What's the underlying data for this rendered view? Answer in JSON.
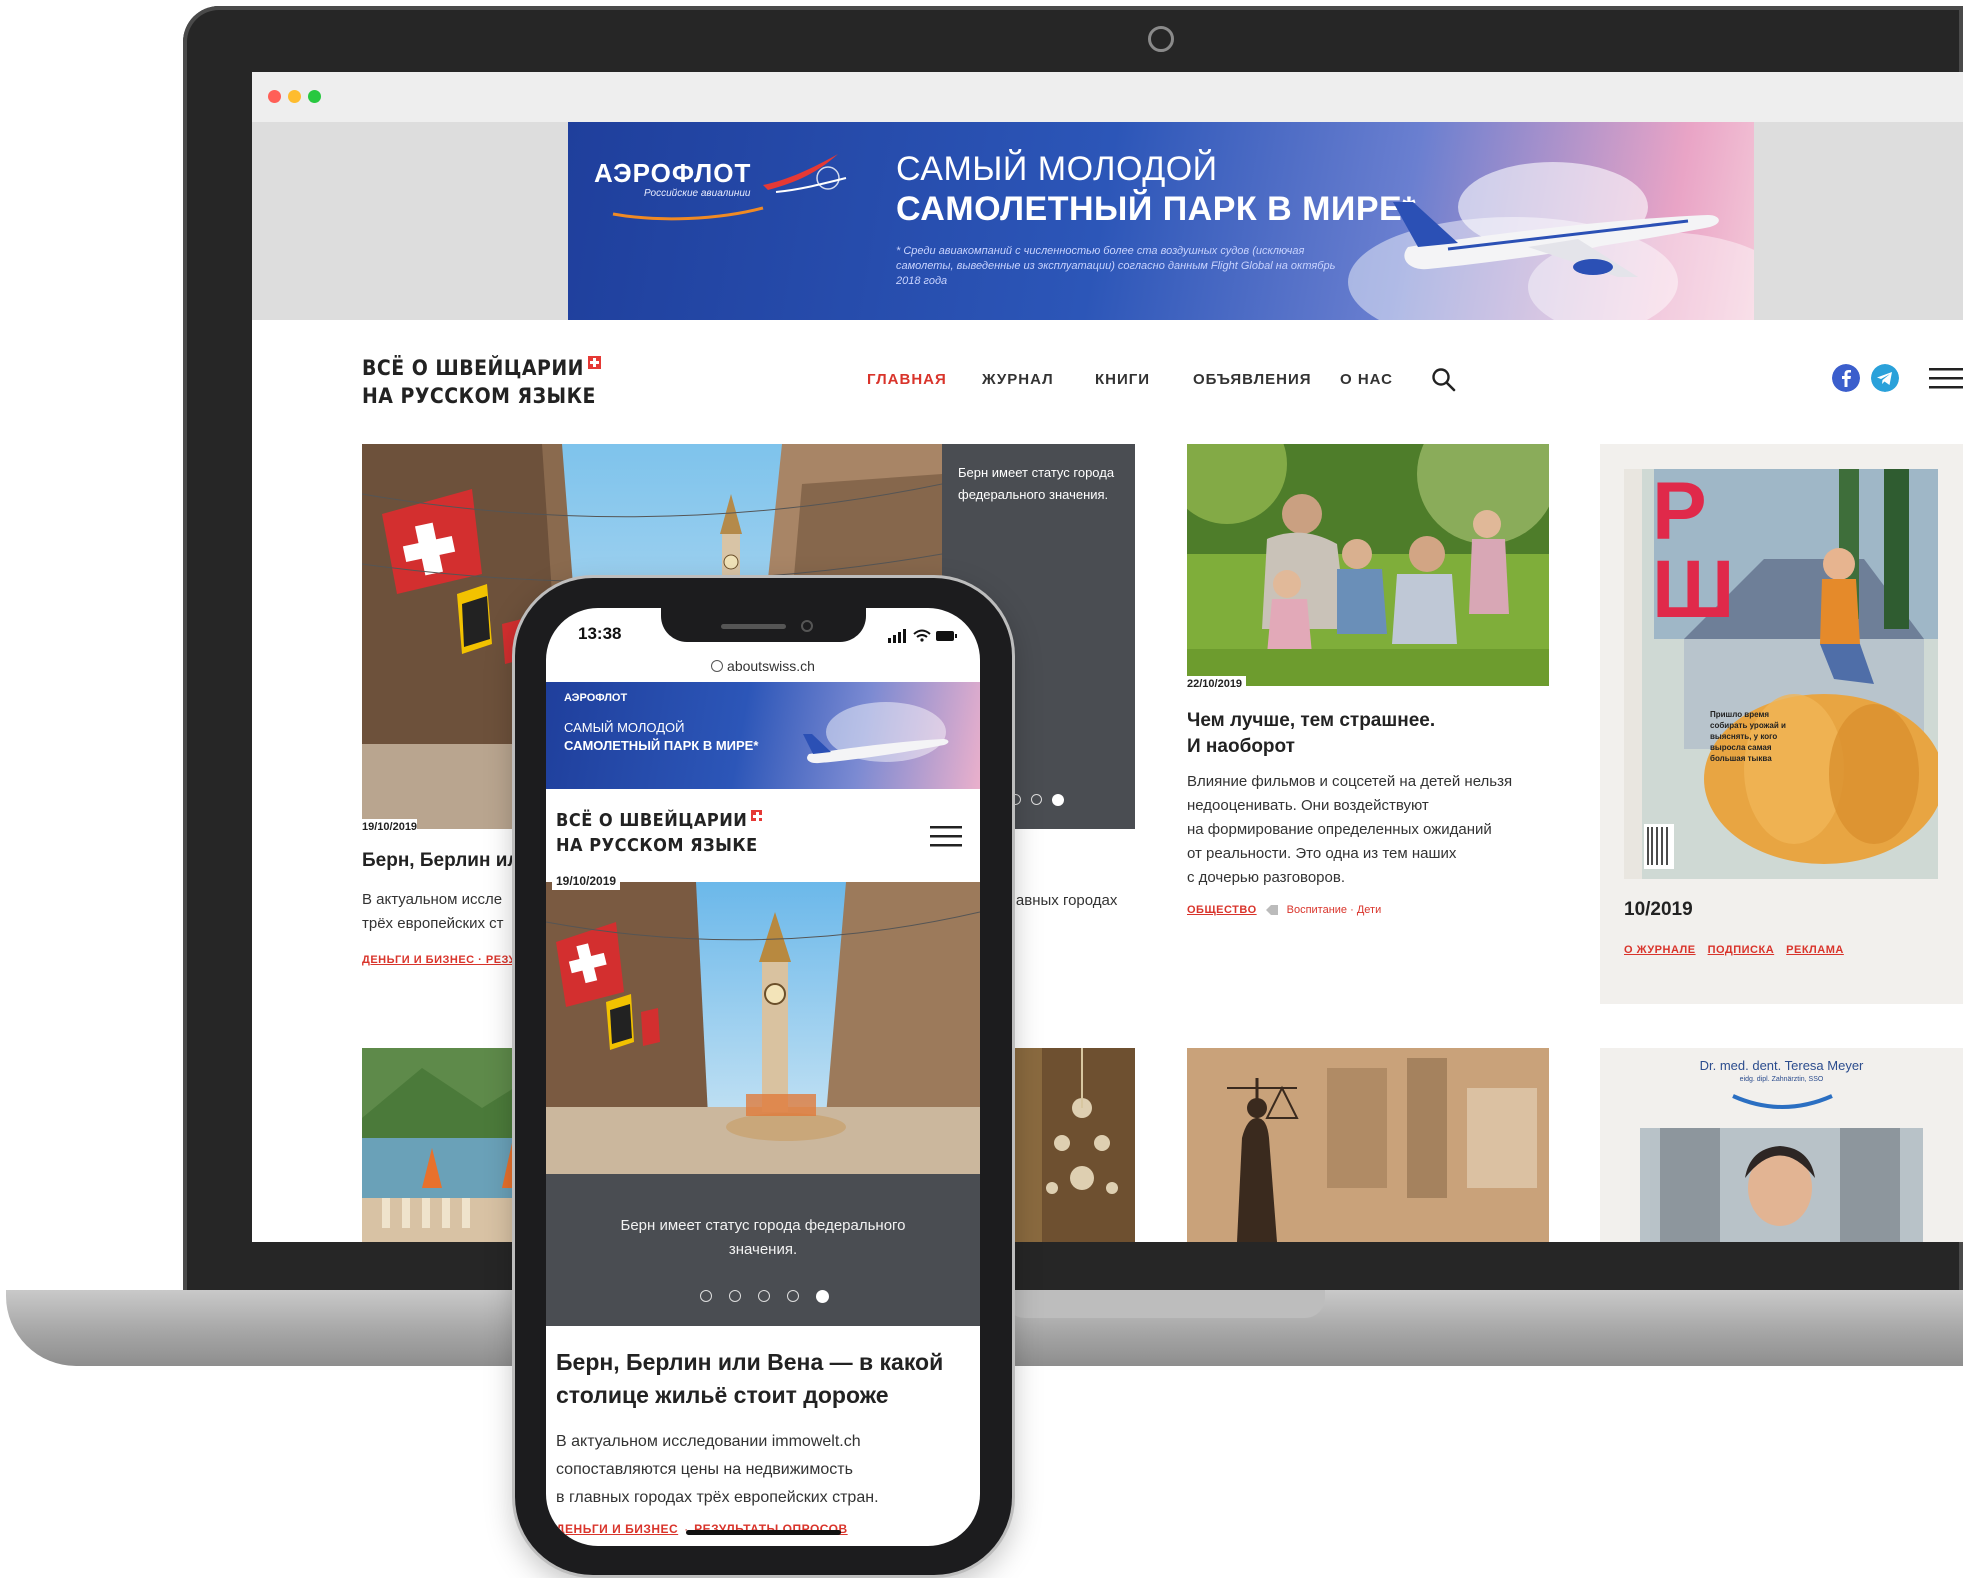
{
  "colors": {
    "accent": "#d9342b",
    "dark_panel": "#4a4d52",
    "banner_blue": "#2c56b8"
  },
  "banner": {
    "brand": "АЭРОФЛОТ",
    "brand_sub": "Российские авиалинии",
    "headline_1": "САМЫЙ МОЛОДОЙ",
    "headline_2": "САМОЛЕТНЫЙ ПАРК В МИРЕ*",
    "footnote": "* Среди авиакомпаний с численностью более ста воздушных судов (исключая самолеты, выведенные из эксплуатации) согласно данным Flight Global на октябрь 2018 года"
  },
  "site": {
    "logo_line1": "ВСЁ О ШВЕЙЦАРИИ",
    "logo_line2": "НА РУССКОМ ЯЗЫКЕ",
    "nav": [
      "ГЛАВНАЯ",
      "ЖУРНАЛ",
      "КНИГИ",
      "ОБЪЯВЛЕНИЯ",
      "О НАС"
    ]
  },
  "feature": {
    "caption": "Берн имеет статус города федерального значения.",
    "date": "19/10/2019",
    "title": "Берн, Берлин или Вена — в какой столице жильё стоит дороже",
    "title_truncated": "Берн, Берлин или",
    "text": "В актуальном исследовании immowelt.ch сопоставляются цены на недвижимость в главных городах трёх европейских стран.",
    "text_line1": "В актуальном иссле",
    "text_line2": "трёх европейских ст",
    "right_fragment": "главных городах",
    "tags_desktop": "ДЕНЬГИ И БИЗНЕС · РЕЗУ",
    "tag1": "ДЕНЬГИ И БИЗНЕС",
    "tag2": "РЕЗУЛЬТАТЫ ОПРОСОВ"
  },
  "article2": {
    "date": "22/10/2019",
    "title_1": "Чем лучше, тем страшнее.",
    "title_2": "И наоборот",
    "text_lines": [
      "Влияние фильмов и соцсетей на детей нельзя",
      "недооценивать. Они воздействуют",
      "на формирование определенных ожиданий",
      "от реальности. Это одна из тем наших",
      "с дочерью разговоров."
    ],
    "tag_main": "ОБЩЕСТВО",
    "tag_sub": "Воспитание · Дети"
  },
  "magazine": {
    "issue": "10/2019",
    "links": [
      "О ЖУРНАЛЕ",
      "ПОДПИСКА",
      "РЕКЛАМА"
    ],
    "cover_letters": "РШ",
    "cover_text": "Пришло время собирать урожай и выяснять, у кого выросла самая большая тыква"
  },
  "ad": {
    "name": "Dr. med. dent. Teresa Meyer",
    "sub": "eidg. dipl. Zahnärztin, SSO"
  },
  "phone": {
    "time": "13:38",
    "url": "aboutswiss.ch",
    "title_1": "Берн, Берлин или Вена — в какой",
    "title_2": "столице жильё стоит дороже",
    "text_1": "В актуальном исследовании immowelt.ch",
    "text_2": "сопоставляются цены на недвижимость",
    "text_3": "в главных городах трёх европейских стран.",
    "caption_1": "Берн имеет статус города федерального",
    "caption_2": "значения."
  },
  "icons": {
    "search": "search-icon",
    "facebook": "facebook-icon",
    "telegram": "telegram-icon",
    "menu": "hamburger-menu-icon"
  }
}
